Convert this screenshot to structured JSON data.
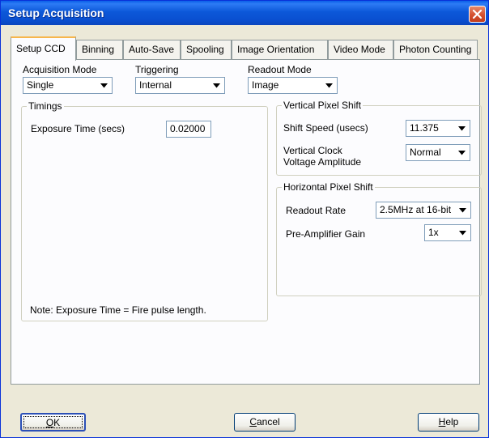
{
  "window": {
    "title": "Setup Acquisition"
  },
  "tabs": [
    {
      "label": "Setup CCD",
      "active": true
    },
    {
      "label": "Binning"
    },
    {
      "label": "Auto-Save"
    },
    {
      "label": "Spooling"
    },
    {
      "label": "Image Orientation"
    },
    {
      "label": "Video Mode"
    },
    {
      "label": "Photon Counting"
    }
  ],
  "acquisition_mode": {
    "label": "Acquisition Mode",
    "value": "Single"
  },
  "triggering": {
    "label": "Triggering",
    "value": "Internal"
  },
  "readout_mode": {
    "label": "Readout Mode",
    "value": "Image"
  },
  "timings": {
    "title": "Timings",
    "exposure_label": "Exposure Time (secs)",
    "exposure_value": "0.02000",
    "note": "Note: Exposure Time = Fire pulse length."
  },
  "vertical_shift": {
    "title": "Vertical Pixel Shift",
    "shift_speed_label": "Shift Speed (usecs)",
    "shift_speed_value": "11.375",
    "clock_label_line1": "Vertical Clock",
    "clock_label_line2": "Voltage Amplitude",
    "clock_value": "Normal"
  },
  "horizontal_shift": {
    "title": "Horizontal Pixel Shift",
    "readout_rate_label": "Readout Rate",
    "readout_rate_value": "2.5MHz at 16-bit",
    "gain_label": "Pre-Amplifier Gain",
    "gain_value": "1x"
  },
  "buttons": {
    "ok_mnemonic": "O",
    "ok_rest": "K",
    "cancel_mnemonic": "C",
    "cancel_rest": "ancel",
    "help_mnemonic": "H",
    "help_rest": "elp"
  },
  "icons": {
    "close": "close-icon",
    "dropdown": "chevron-down-icon"
  },
  "colors": {
    "title_bar": "#0a58d8",
    "close_button": "#d5502e",
    "tab_highlight": "#f7b64c"
  }
}
